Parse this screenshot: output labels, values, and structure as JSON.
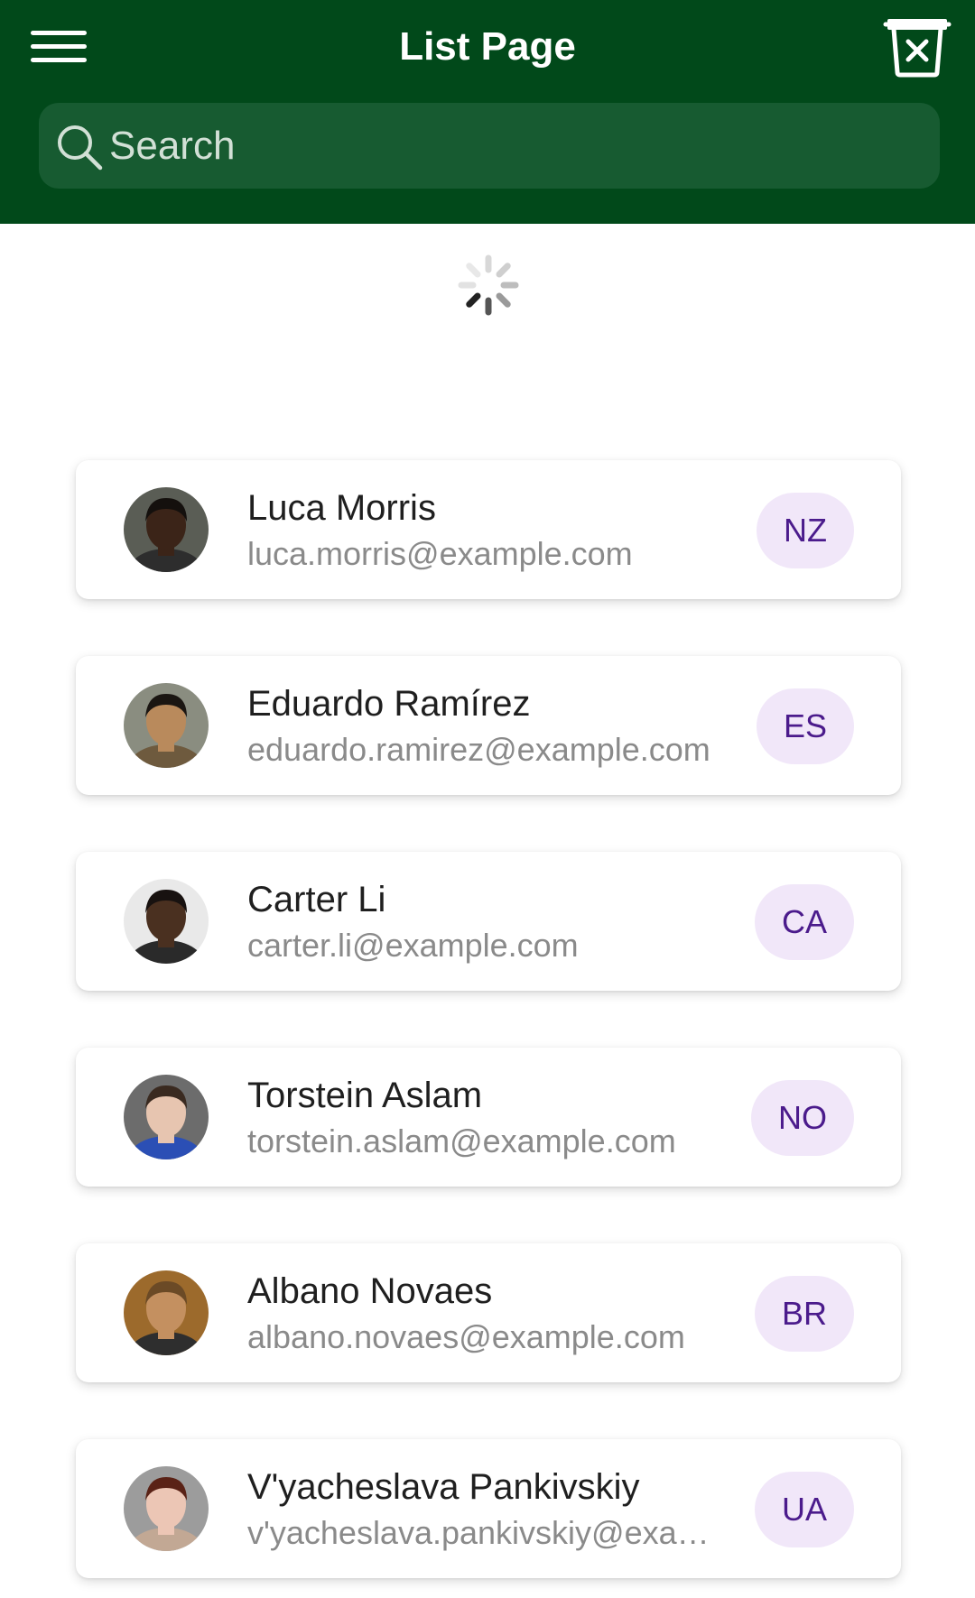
{
  "app_bar": {
    "title": "List Page",
    "menu_icon": "hamburger-menu-icon",
    "trash_icon": "delete-all-trash-icon",
    "background": "#01491a"
  },
  "search": {
    "placeholder": "Search",
    "value": "",
    "icon": "search-icon"
  },
  "loading": {
    "indicator": "spinner-icon"
  },
  "people": [
    {
      "name": "Luca Morris",
      "email": "luca.morris@example.com",
      "country": "NZ",
      "skin": "#3b2418",
      "hair": "#14100d",
      "shirt": "#2d2d2d",
      "bg": "#5a5d55"
    },
    {
      "name": "Eduardo Ramírez",
      "email": "eduardo.ramirez@example.com",
      "country": "ES",
      "skin": "#b98a5c",
      "hair": "#1b1612",
      "shirt": "#6e5a3e",
      "bg": "#8a8d80"
    },
    {
      "name": "Carter Li",
      "email": "carter.li@example.com",
      "country": "CA",
      "skin": "#4a3020",
      "hair": "#181210",
      "shirt": "#2a2a2a",
      "bg": "#e9e9e9"
    },
    {
      "name": "Torstein Aslam",
      "email": "torstein.aslam@example.com",
      "country": "NO",
      "skin": "#e7c5b0",
      "hair": "#3a2a20",
      "shirt": "#2b4fb5",
      "bg": "#6c6c6c"
    },
    {
      "name": "Albano Novaes",
      "email": "albano.novaes@example.com",
      "country": "BR",
      "skin": "#c49060",
      "hair": "#6b4a26",
      "shirt": "#2e2e2e",
      "bg": "#9c6a2c"
    },
    {
      "name": "V'yacheslava Pankivskiy",
      "email": "v'yacheslava.pankivskiy@example.com",
      "country": "UA",
      "skin": "#ecc6b5",
      "hair": "#5a2216",
      "shirt": "#c2a894",
      "bg": "#9c9c9c"
    }
  ],
  "colors": {
    "badge_bg": "#f1e7f9",
    "badge_text": "#4b1b8c",
    "search_bg": "#175b31"
  }
}
